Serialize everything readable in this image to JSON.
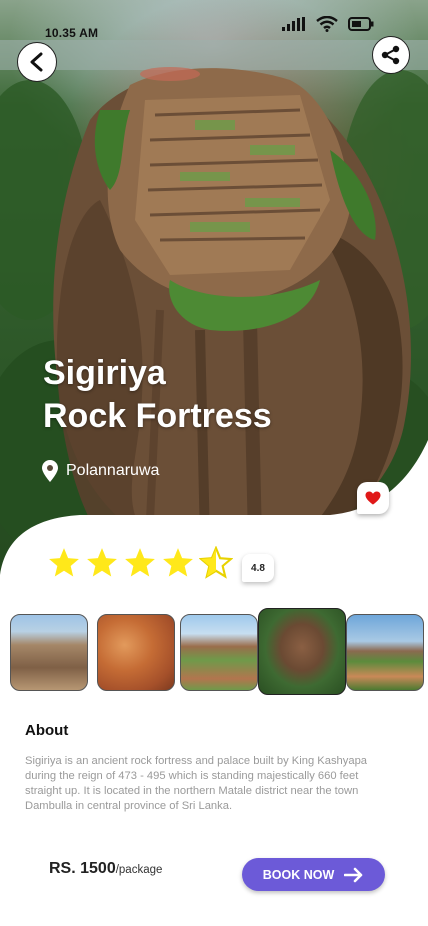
{
  "status_bar": {
    "time": "10.35 AM"
  },
  "header": {
    "back_icon": "chevron-left-icon",
    "share_icon": "share-icon"
  },
  "place": {
    "title_line1": "Sigiriya",
    "title_line2": "Rock Fortress",
    "location": "Polannaruwa",
    "location_icon": "map-pin-icon"
  },
  "rating": {
    "stars": 4.5,
    "max": 5,
    "value": "4.8",
    "star_color": "#ffe81a"
  },
  "gallery": {
    "items": [
      "rock-with-lion-paws",
      "fresco-maidens",
      "fortress-from-afar",
      "fortress-aerial",
      "garden-path-to-rock"
    ]
  },
  "about": {
    "heading": "About",
    "text": "Sigiriya is an ancient rock fortress and palace built by King Kashyapa during the reign of 473 - 495 which is standing majestically 660 feet straight up. It is located in the northern Matale district near the town Dambulla in central province of Sri Lanka."
  },
  "booking": {
    "price": "RS. 1500",
    "unit": "/package",
    "button_label": "BOOK NOW",
    "accent": "#6c5ad8"
  },
  "favorite": {
    "heart_color": "#e01818"
  }
}
